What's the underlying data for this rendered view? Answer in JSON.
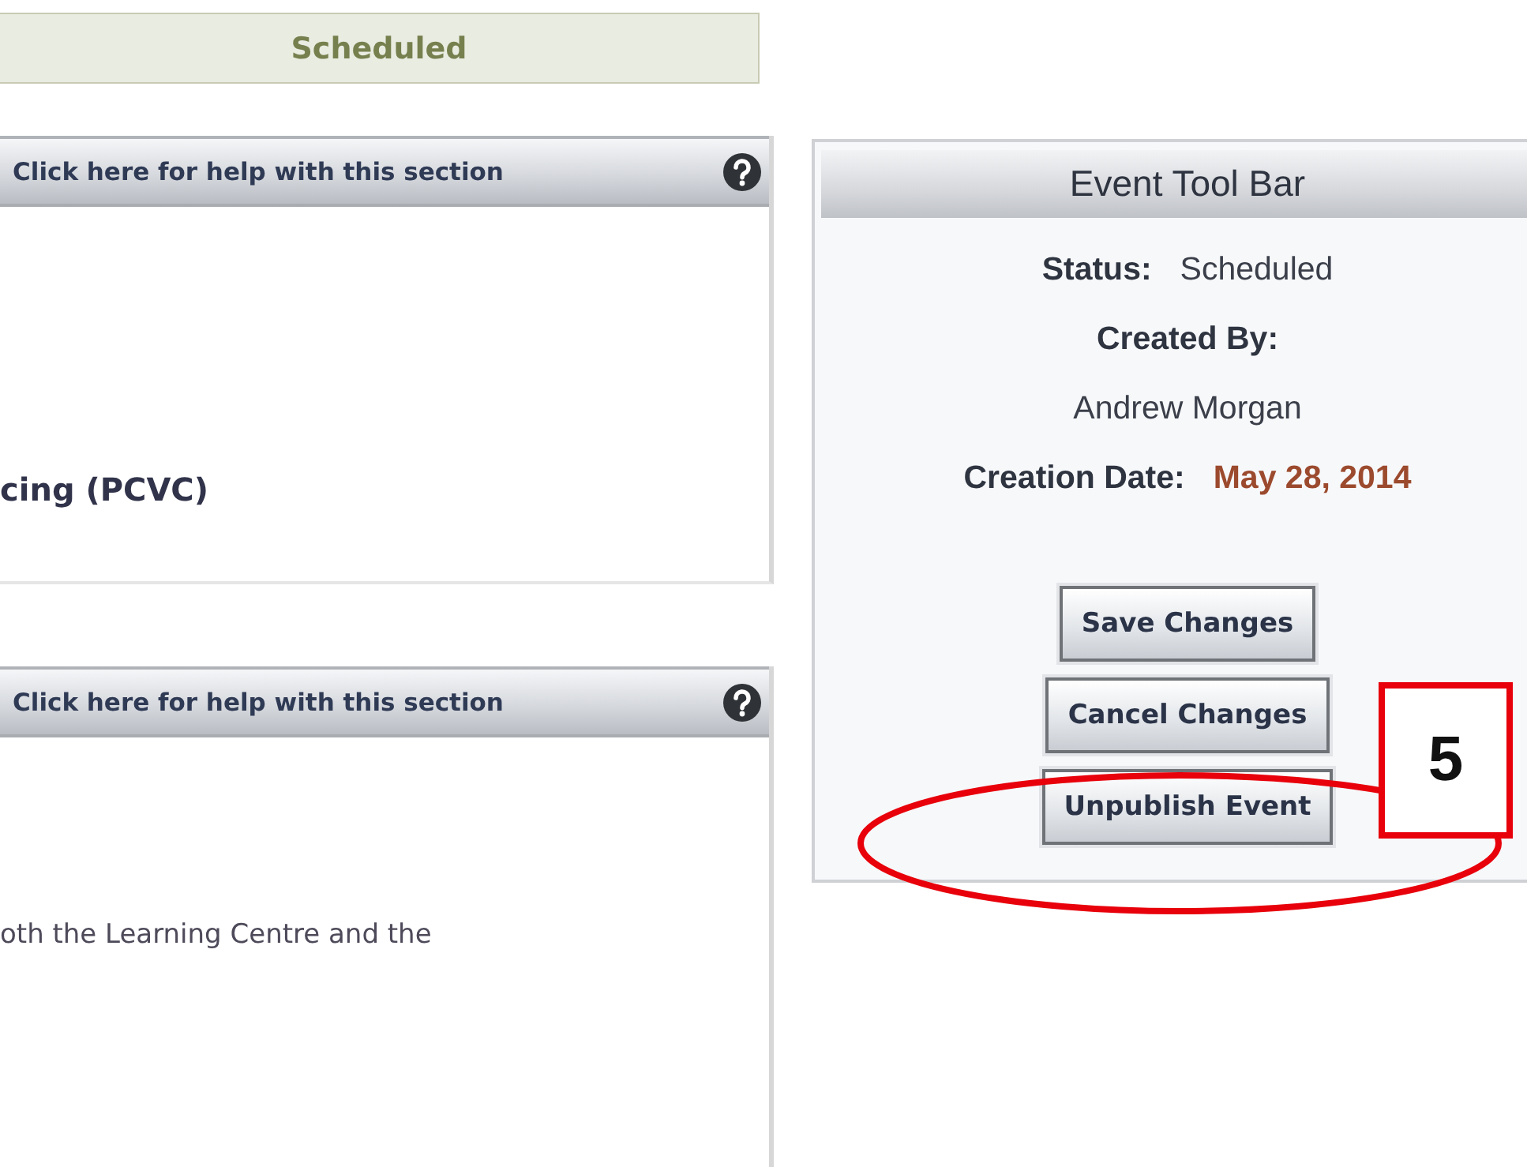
{
  "status_banner": {
    "text": "Scheduled"
  },
  "sections": [
    {
      "help_link": "Click here for help with this section",
      "lines": [
        {
          "text": "cing (PCVC)",
          "bold": true
        }
      ]
    },
    {
      "help_link": "Click here for help with this section",
      "lines": [
        {
          "text": "oth the Learning Centre and the",
          "bold": false
        }
      ]
    }
  ],
  "event_toolbar": {
    "title": "Event Tool Bar",
    "fields": [
      {
        "label": "Status:",
        "value": "Scheduled",
        "kind": "inline",
        "highlight": false
      },
      {
        "label": "Created By:",
        "value": "Andrew Morgan",
        "kind": "stacked",
        "highlight": false
      },
      {
        "label": "Creation Date:",
        "value": "May 28, 2014",
        "kind": "inline",
        "highlight": true
      }
    ],
    "buttons": [
      "Save Changes",
      "Cancel Changes",
      "Unpublish Event"
    ]
  },
  "annotation": {
    "label": "5"
  }
}
